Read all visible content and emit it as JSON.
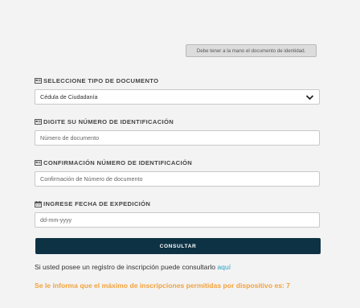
{
  "hint": "Debe tener a la mano el documento de identidad.",
  "doc_type": {
    "label": "SELECCIONE TIPO DE DOCUMENTO",
    "selected": "Cédula de Ciudadanía",
    "icon": "id-card-icon"
  },
  "id_number": {
    "label": "DIGITE SU NÚMERO DE IDENTIFICACIÓN",
    "placeholder": "Número de documento",
    "icon": "id-card-icon"
  },
  "id_confirm": {
    "label": "CONFIRMACIÓN NÚMERO DE IDENTIFICACIÓN",
    "placeholder": "Confirmación de Número de documento",
    "icon": "id-card-icon"
  },
  "issue_date": {
    "label": "INGRESE FECHA DE EXPEDICIÓN",
    "placeholder": "dd-mm-yyyy",
    "icon": "calendar-icon"
  },
  "submit_label": "CONSULTAR",
  "info": {
    "text": "Si usted posee un registro de inscripción puede consultarlo ",
    "link": "aquí"
  },
  "warning": "Se le informa que el máximo de inscripciones permitidas por dispositivo es: 7",
  "colors": {
    "button": "#0d3244",
    "link": "#2a9fc6",
    "warning": "#f2a23c"
  }
}
